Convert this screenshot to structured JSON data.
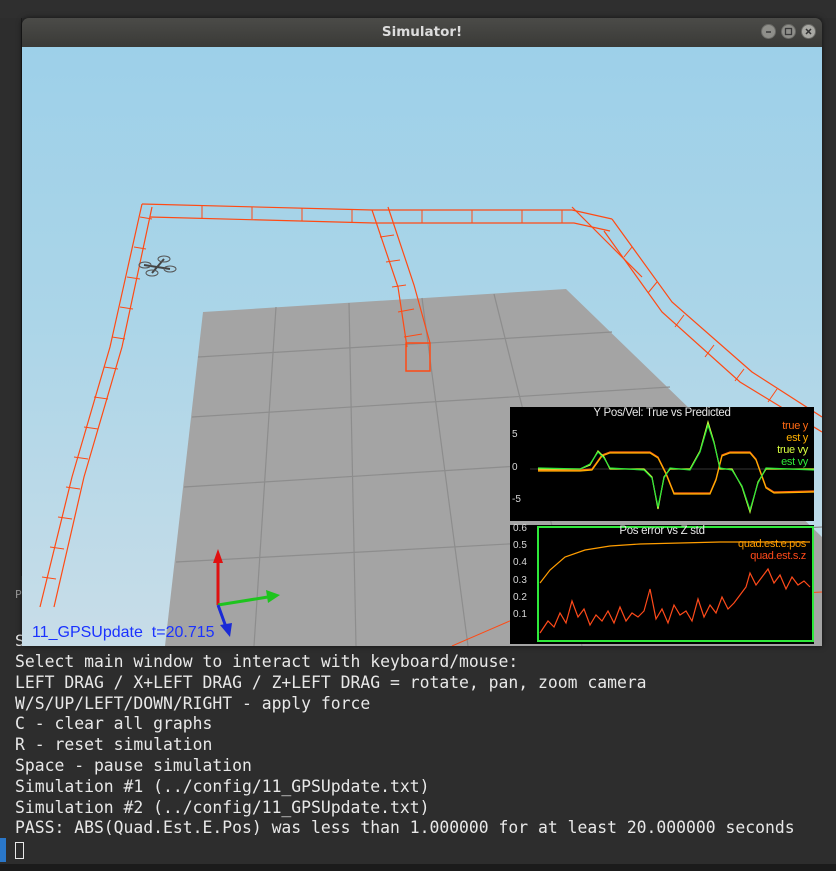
{
  "window": {
    "title": "Simulator!",
    "status_label": "11_GPSUpdate  t=20.715"
  },
  "plot1": {
    "title": "Y Pos/Vel: True vs Predicted",
    "legend": [
      {
        "label": "true y",
        "color": "#ff6a14"
      },
      {
        "label": "est y",
        "color": "#ffb000"
      },
      {
        "label": "true vy",
        "color": "#d8ff40"
      },
      {
        "label": "est vy",
        "color": "#2ee83a"
      }
    ],
    "yticks": [
      "5",
      "0",
      "-5"
    ]
  },
  "plot2": {
    "title": "Pos error vs Z std",
    "legend": [
      {
        "label": "quad.est.e.pos",
        "color": "#ff9d00"
      },
      {
        "label": "quad.est.s.z",
        "color": "#ff4a1a"
      }
    ],
    "yticks": [
      "0.6",
      "0.5",
      "0.4",
      "0.3",
      "0.2",
      "0.1"
    ],
    "border_color": "#2ee83a"
  },
  "terminal": {
    "hidden_line": "Simulation",
    "lines": [
      "Select main window to interact with keyboard/mouse:",
      "LEFT DRAG / X+LEFT DRAG / Z+LEFT DRAG = rotate, pan, zoom camera",
      "W/S/UP/LEFT/DOWN/RIGHT - apply force",
      "C - clear all graphs",
      "R - reset simulation",
      "Space - pause simulation",
      "Simulation #1 (../config/11_GPSUpdate.txt)",
      "Simulation #2 (../config/11_GPSUpdate.txt)",
      "PASS: ABS(Quad.Est.E.Pos) was less than 1.000000 for at least 20.000000 seconds"
    ]
  },
  "edge_label": "P",
  "colors": {
    "trajectory": "#ff4a14",
    "floor": "#a3a3a3",
    "axis_x": "#1ec41e",
    "axis_y": "#e01010",
    "axis_z": "#1a2ad6"
  }
}
